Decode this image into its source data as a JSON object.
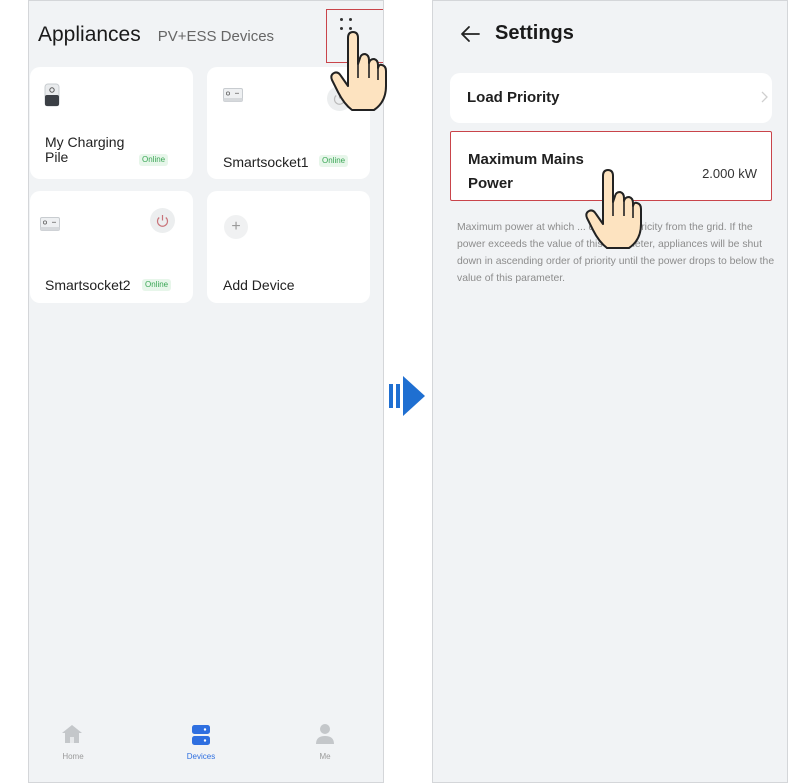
{
  "left_screen": {
    "title": "Appliances",
    "subtitle_tab": "PV+ESS Devices",
    "more_icon": "four-dot-menu-icon",
    "devices": [
      {
        "name": "My Charging Pile",
        "status": "Online",
        "icon": "charging-pile-icon",
        "power_button": false
      },
      {
        "name": "Smartsocket1",
        "status": "Online",
        "icon": "smart-socket-icon",
        "power_button": true
      },
      {
        "name": "Smartsocket2",
        "status": "Online",
        "icon": "smart-socket-icon",
        "power_button": true
      }
    ],
    "add_device_label": "Add Device",
    "nav": [
      {
        "label": "Home",
        "icon": "home-icon",
        "active": false
      },
      {
        "label": "Devices",
        "icon": "devices-icon",
        "active": true
      },
      {
        "label": "Me",
        "icon": "person-icon",
        "active": false
      }
    ]
  },
  "right_screen": {
    "title": "Settings",
    "back_icon": "back-arrow-icon",
    "rows": [
      {
        "label": "Load Priority",
        "value": "",
        "chevron": true
      },
      {
        "label": "Maximum Mains Power",
        "value": "2.000 kW",
        "chevron": false
      }
    ],
    "description": "Maximum power at which ... draws electricity from the grid. If the power exceeds the value of this parameter, appliances will be shut down in ascending order of priority until the power drops to below the value of this parameter."
  },
  "colors": {
    "accent": "#2f6fe0",
    "online": "#3aa655",
    "highlight_border": "#c9444a",
    "arrow": "#1f6fd1",
    "background": "#f1f3f5"
  }
}
